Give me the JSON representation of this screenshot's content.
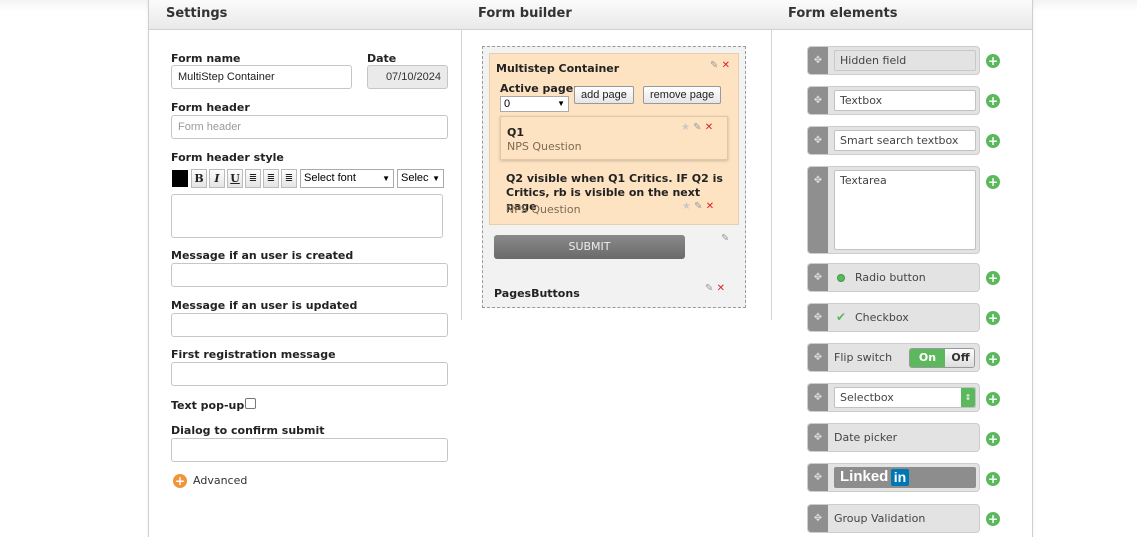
{
  "headers": {
    "settings": "Settings",
    "form_builder": "Form builder",
    "form_elements": "Form elements"
  },
  "settings": {
    "form_name_label": "Form name",
    "form_name_value": "MultiStep Container",
    "date_label": "Date",
    "date_value": "07/10/2024",
    "form_header_label": "Form header",
    "form_header_placeholder": "Form header",
    "form_header_style_label": "Form header style",
    "toolbar": {
      "bold": "B",
      "italic": "I",
      "underline": "U",
      "font_select": "Select font",
      "size_select": "Selec"
    },
    "msg_created_label": "Message if an user is created",
    "msg_updated_label": "Message if an user is updated",
    "first_reg_label": "First registration message",
    "text_popup_label": "Text pop-up",
    "dialog_confirm_label": "Dialog to confirm submit",
    "advanced_label": "Advanced"
  },
  "builder": {
    "container_title": "Multistep Container",
    "active_page_label": "Active page:",
    "active_page_value": "0",
    "add_page": "add page",
    "remove_page": "remove page",
    "q1_title": "Q1",
    "q1_subtitle": "NPS Question",
    "q2_title": "Q2 visible when Q1 Critics. IF Q2 is Critics, rb is visible on the next page",
    "q2_subtitle": "NPS Question",
    "submit": "SUBMIT",
    "pages_buttons": "PagesButtons"
  },
  "elements": {
    "hidden_field": "Hidden field",
    "textbox": "Textbox",
    "smart_search": "Smart search textbox",
    "textarea": "Textarea",
    "radio_button": "Radio button",
    "checkbox": "Checkbox",
    "flip_switch": "Flip switch",
    "flip_on": "On",
    "flip_off": "Off",
    "selectbox": "Selectbox",
    "date_picker": "Date picker",
    "linkedin": "Linked",
    "linkedin_in": "in",
    "group_validation": "Group Validation"
  },
  "colors": {
    "accent_green": "#5cb85c",
    "container_bg": "#fde3c2",
    "advanced_orange": "#f0963a",
    "linkedin_blue": "#0077b5"
  }
}
